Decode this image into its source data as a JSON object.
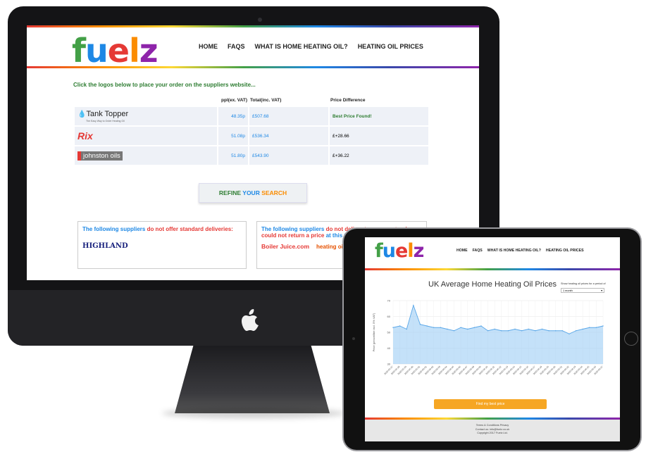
{
  "brand": {
    "letters": [
      "f",
      "u",
      "e",
      "l",
      "z"
    ]
  },
  "nav": [
    "HOME",
    "FAQS",
    "WHAT IS HOME HEATING OIL?",
    "HEATING OIL PRICES"
  ],
  "desktop": {
    "lead": "Click the logos below to place your order on the suppliers website...",
    "columns": [
      "ppl(ex. VAT)",
      "Total(inc. VAT)",
      "Price Difference"
    ],
    "rows": [
      {
        "supplier": "Tank Topper",
        "tagline": "The Easy Way to Order Heating Oil",
        "ppl": "48.35p",
        "total": "£507.68",
        "diff": "Best Price Found!"
      },
      {
        "supplier": "Rix",
        "tagline": "",
        "ppl": "51.08p",
        "total": "£536.34",
        "diff": "£+28.66"
      },
      {
        "supplier": "johnston oils",
        "tagline": "",
        "ppl": "51.80p",
        "total": "£543.90",
        "diff": "£+36.22"
      }
    ],
    "refine": {
      "a": "REFINE ",
      "b": "YOUR ",
      "c": "SEARCH"
    },
    "box1": {
      "t1": "The following suppliers ",
      "t2": "do not offer standard deliveries:",
      "logo": "HIGHLAND"
    },
    "box2": {
      "t1": "The following suppliers ",
      "t2": "do not deliver to your postcode or could not return a price ",
      "t3": "at this time",
      "logo1": "Boiler Juice.com",
      "logo2": "heating oil.co"
    }
  },
  "tablet": {
    "chart_title": "UK Average Home Heating Oil Prices",
    "select_label": "Show heating oil prices for a period of",
    "select_value": "1 month",
    "cta": "Find my best price",
    "footer": [
      "Terms & Conditions   Privacy",
      "Contact us: info@fuelz.co.uk",
      "Copyright 2017 Fuelz Ltd."
    ]
  },
  "chart_data": {
    "type": "area",
    "title": "UK Average Home Heating Oil Prices",
    "ylabel": "Price (pence/litre incl. 5% VAT)",
    "ylim": [
      30,
      70
    ],
    "yticks": [
      30,
      40,
      50,
      60,
      70
    ],
    "x": [
      "2020-05-27",
      "2020-05-28",
      "2020-05-29",
      "2020-05-30",
      "2020-05-31",
      "2020-06-01",
      "2020-06-02",
      "2020-06-03",
      "2020-06-04",
      "2020-06-05",
      "2020-06-06",
      "2020-06-07",
      "2020-06-08",
      "2020-06-09",
      "2020-06-10",
      "2020-06-11",
      "2020-06-12",
      "2020-06-13",
      "2020-06-14",
      "2020-06-15",
      "2020-06-16",
      "2020-06-17",
      "2020-06-18",
      "2020-06-19",
      "2020-06-20",
      "2020-06-21",
      "2020-06-22",
      "2020-06-23",
      "2020-06-24",
      "2020-06-25",
      "2020-06-26",
      "2020-06-27"
    ],
    "values": [
      53,
      54,
      52,
      67,
      55,
      54,
      53,
      53,
      52,
      51,
      53,
      52,
      53,
      54,
      51,
      52,
      51,
      51,
      52,
      51,
      52,
      51,
      52,
      51,
      51,
      51,
      49,
      51,
      52,
      53,
      53,
      54
    ],
    "color": "#9ccdf5",
    "line_color": "#5aa7e8"
  }
}
